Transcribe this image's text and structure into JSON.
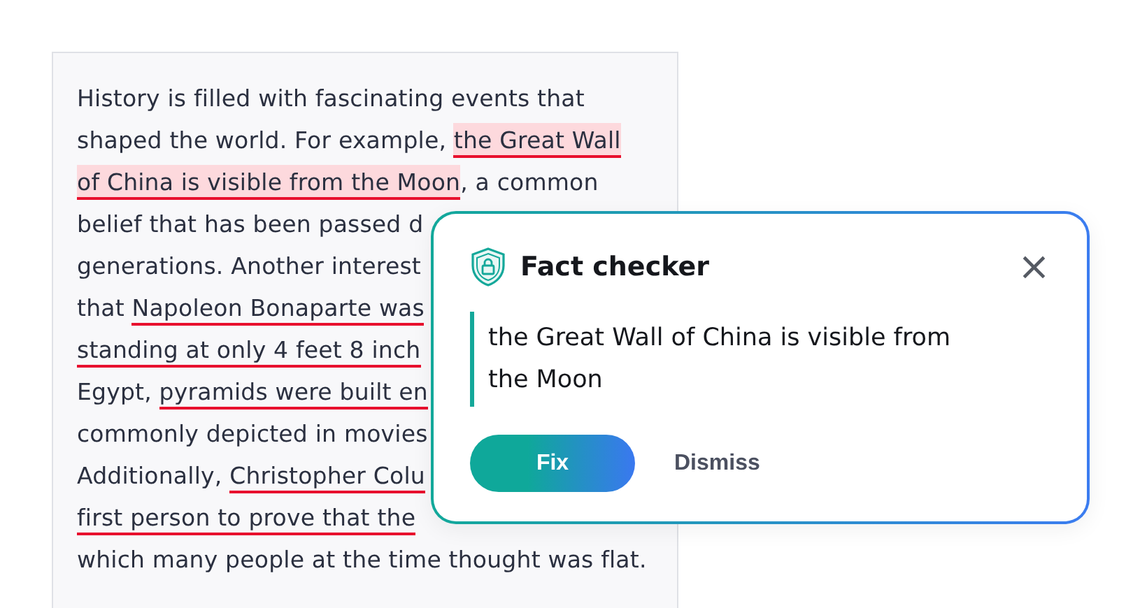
{
  "document": {
    "lines": [
      [
        {
          "text": "History is filled with fascinating events that",
          "flagged": false,
          "highlighted": false
        }
      ],
      [
        {
          "text": "shaped the world. For example, ",
          "flagged": false,
          "highlighted": false
        },
        {
          "text": "the Great Wall",
          "flagged": true,
          "highlighted": true
        }
      ],
      [
        {
          "text": "of China is visible from the Moon",
          "flagged": true,
          "highlighted": true
        },
        {
          "text": ", a common",
          "flagged": false,
          "highlighted": false
        }
      ],
      [
        {
          "text": "belief that has been passed d",
          "flagged": false,
          "highlighted": false
        }
      ],
      [
        {
          "text": "generations. Another interest",
          "flagged": false,
          "highlighted": false
        }
      ],
      [
        {
          "text": "that ",
          "flagged": false,
          "highlighted": false
        },
        {
          "text": "Napoleon Bonaparte was",
          "flagged": true,
          "highlighted": false
        }
      ],
      [
        {
          "text": "standing at only 4 feet 8 inch",
          "flagged": true,
          "highlighted": false
        }
      ],
      [
        {
          "text": "Egypt, ",
          "flagged": false,
          "highlighted": false
        },
        {
          "text": "pyramids were built en",
          "flagged": true,
          "highlighted": false
        }
      ],
      [
        {
          "text": "commonly depicted in movies",
          "flagged": false,
          "highlighted": false
        }
      ],
      [
        {
          "text": "Additionally, ",
          "flagged": false,
          "highlighted": false
        },
        {
          "text": "Christopher Colu",
          "flagged": true,
          "highlighted": false
        }
      ],
      [
        {
          "text": "first person to prove that the",
          "flagged": true,
          "highlighted": false
        }
      ],
      [
        {
          "text": "which many people at the time thought was flat.",
          "flagged": false,
          "highlighted": false
        }
      ]
    ]
  },
  "popup": {
    "title": "Fact checker",
    "close": "×",
    "quote": "the Great Wall of China is visible from the Moon",
    "buttons": [
      {
        "label": "Fix",
        "kind": "primary"
      },
      {
        "label": "Dismiss",
        "kind": "text"
      }
    ]
  }
}
